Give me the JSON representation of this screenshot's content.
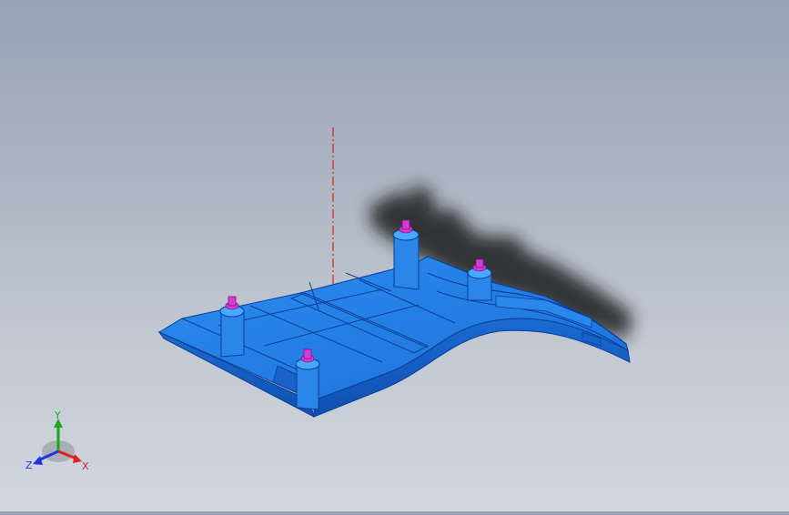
{
  "viewport": {
    "model": {
      "part_color": "#1f7fe0",
      "part_edge_color": "#0a3f9a",
      "screw_color": "#d63bd8",
      "axis_line_color": "#e0201c",
      "shadow_color": "#1a1a1a"
    },
    "triad": {
      "x_label": "X",
      "y_label": "Y",
      "z_label": "Z",
      "x_color": "#e02020",
      "y_color": "#1ea51e",
      "z_color": "#2233e0"
    }
  }
}
